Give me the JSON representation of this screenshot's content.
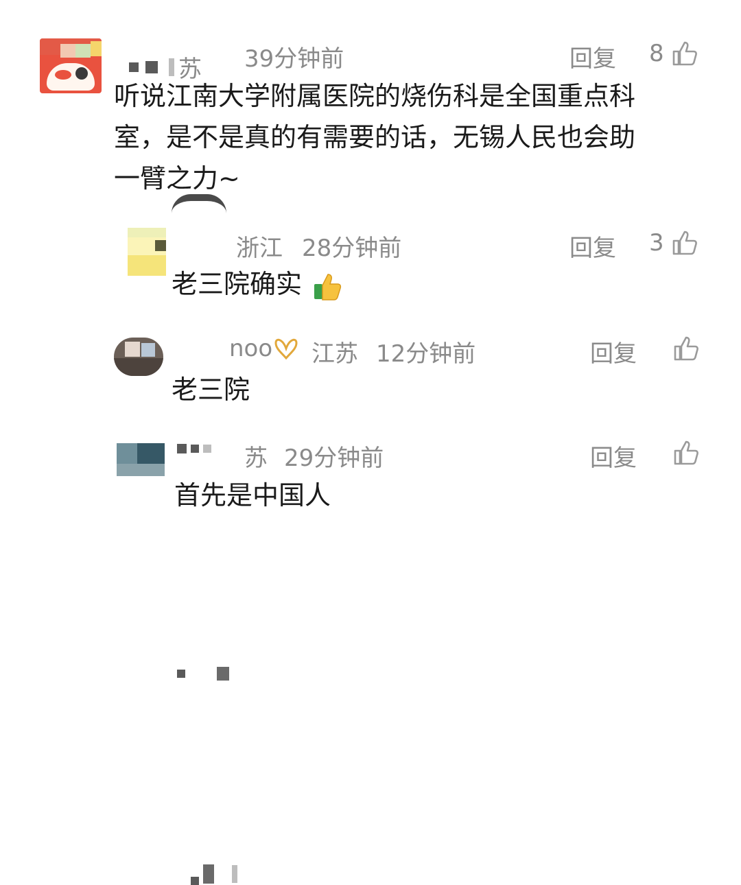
{
  "comments": [
    {
      "nickname_fragment": "苏",
      "meta": "39分钟前",
      "reply_label": "回复",
      "likes": "8",
      "text_lines": [
        "听说江南大学附属医院的烧伤科是全国重点科",
        "室，是不是真的有需要的话，无锡人民也会助",
        "一臂之力~"
      ]
    },
    {
      "location": "浙江",
      "meta": "28分钟前",
      "reply_label": "回复",
      "likes": "3",
      "text": "老三院确实",
      "emoji": "thumbs-up-icon"
    },
    {
      "nickname_fragment": "noo",
      "location": "江苏",
      "meta": "12分钟前",
      "reply_label": "回复",
      "likes": "",
      "text": "老三院"
    },
    {
      "nickname_fragment": "苏",
      "meta": "29分钟前",
      "reply_label": "回复",
      "likes": "",
      "text": "首先是中国人"
    }
  ],
  "colors": {
    "meta_gray": "#8a8a8a",
    "text_dark": "#1a1a1a",
    "badge_gold": "#e2a83b"
  }
}
